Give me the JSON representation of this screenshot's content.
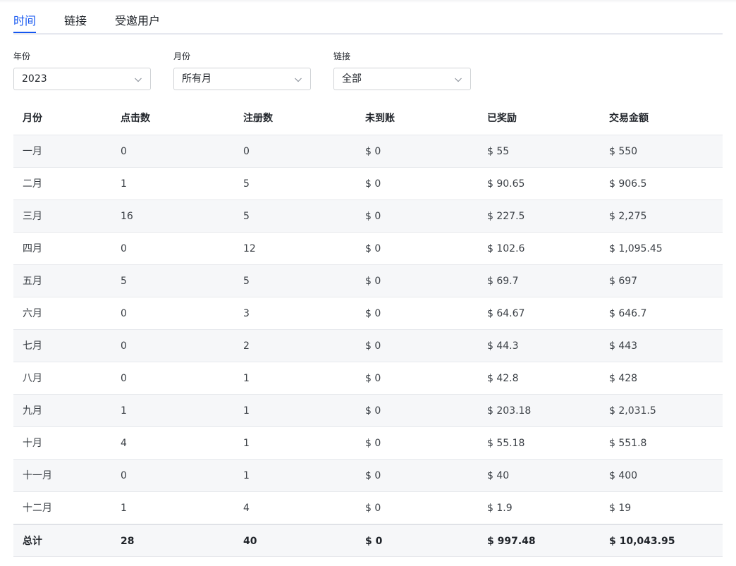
{
  "tabs": [
    {
      "label": "时间",
      "active": true
    },
    {
      "label": "链接",
      "active": false
    },
    {
      "label": "受邀用户",
      "active": false
    }
  ],
  "filters": {
    "year": {
      "label": "年份",
      "value": "2023"
    },
    "month": {
      "label": "月份",
      "value": "所有月"
    },
    "link": {
      "label": "链接",
      "value": "全部"
    }
  },
  "colors": {
    "accent": "#1456f0",
    "stripe": "#f6f7f9",
    "border": "#e7e9ed"
  },
  "icons": {
    "select_chevron": "chevron-down-icon"
  },
  "table": {
    "columns": [
      "月份",
      "点击数",
      "注册数",
      "未到账",
      "已奖励",
      "交易金额"
    ],
    "rows": [
      [
        "一月",
        "0",
        "0",
        "$ 0",
        "$ 55",
        "$ 550"
      ],
      [
        "二月",
        "1",
        "5",
        "$ 0",
        "$ 90.65",
        "$ 906.5"
      ],
      [
        "三月",
        "16",
        "5",
        "$ 0",
        "$ 227.5",
        "$ 2,275"
      ],
      [
        "四月",
        "0",
        "12",
        "$ 0",
        "$ 102.6",
        "$ 1,095.45"
      ],
      [
        "五月",
        "5",
        "5",
        "$ 0",
        "$ 69.7",
        "$ 697"
      ],
      [
        "六月",
        "0",
        "3",
        "$ 0",
        "$ 64.67",
        "$ 646.7"
      ],
      [
        "七月",
        "0",
        "2",
        "$ 0",
        "$ 44.3",
        "$ 443"
      ],
      [
        "八月",
        "0",
        "1",
        "$ 0",
        "$ 42.8",
        "$ 428"
      ],
      [
        "九月",
        "1",
        "1",
        "$ 0",
        "$ 203.18",
        "$ 2,031.5"
      ],
      [
        "十月",
        "4",
        "1",
        "$ 0",
        "$ 55.18",
        "$ 551.8"
      ],
      [
        "十一月",
        "0",
        "1",
        "$ 0",
        "$ 40",
        "$ 400"
      ],
      [
        "十二月",
        "1",
        "4",
        "$ 0",
        "$ 1.9",
        "$ 19"
      ]
    ],
    "total": [
      "总计",
      "28",
      "40",
      "$ 0",
      "$ 997.48",
      "$ 10,043.95"
    ]
  }
}
